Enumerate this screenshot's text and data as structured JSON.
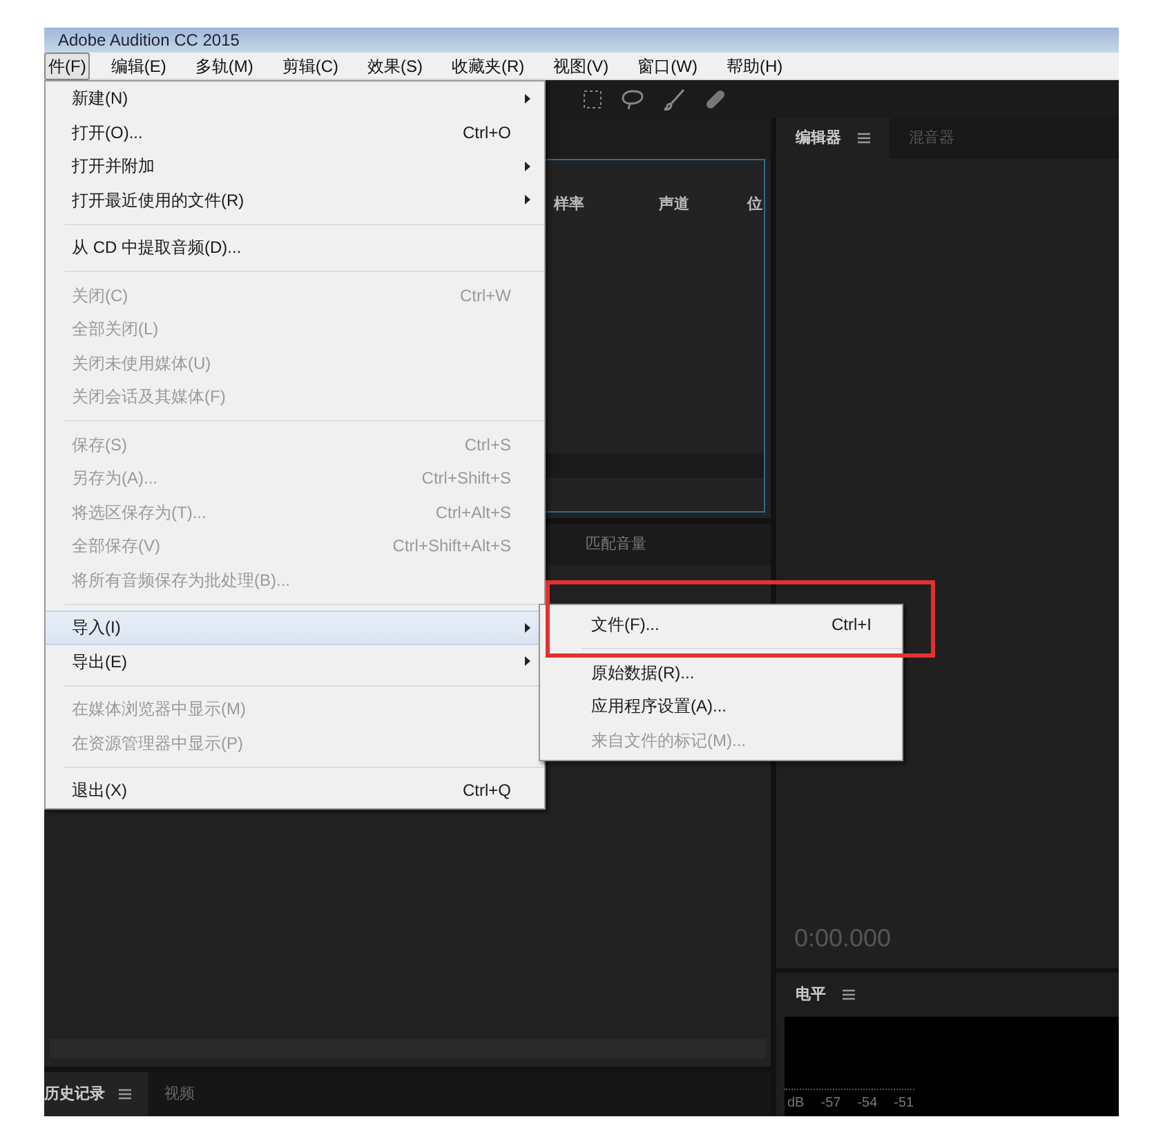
{
  "window": {
    "title": "Adobe Audition CC 2015"
  },
  "menubar": [
    {
      "label": "件(F)",
      "selected": true
    },
    {
      "label": "编辑(E)",
      "selected": false
    },
    {
      "label": "多轨(M)",
      "selected": false
    },
    {
      "label": "剪辑(C)",
      "selected": false
    },
    {
      "label": "效果(S)",
      "selected": false
    },
    {
      "label": "收藏夹(R)",
      "selected": false
    },
    {
      "label": "视图(V)",
      "selected": false
    },
    {
      "label": "窗口(W)",
      "selected": false
    },
    {
      "label": "帮助(H)",
      "selected": false
    }
  ],
  "file_menu": [
    {
      "kind": "item",
      "label": "新建(N)",
      "submenu": true,
      "disabled": false,
      "selected": false
    },
    {
      "kind": "item",
      "label": "打开(O)...",
      "shortcut": "Ctrl+O",
      "submenu": false,
      "disabled": false,
      "selected": false
    },
    {
      "kind": "item",
      "label": "打开并附加",
      "submenu": true,
      "disabled": false,
      "selected": false
    },
    {
      "kind": "item",
      "label": "打开最近使用的文件(R)",
      "submenu": true,
      "disabled": false,
      "selected": false
    },
    {
      "kind": "separator"
    },
    {
      "kind": "item",
      "label": "从 CD 中提取音频(D)...",
      "submenu": false,
      "disabled": false,
      "selected": false
    },
    {
      "kind": "separator"
    },
    {
      "kind": "item",
      "label": "关闭(C)",
      "shortcut": "Ctrl+W",
      "submenu": false,
      "disabled": true,
      "selected": false
    },
    {
      "kind": "item",
      "label": "全部关闭(L)",
      "submenu": false,
      "disabled": true,
      "selected": false
    },
    {
      "kind": "item",
      "label": "关闭未使用媒体(U)",
      "submenu": false,
      "disabled": true,
      "selected": false
    },
    {
      "kind": "item",
      "label": "关闭会话及其媒体(F)",
      "submenu": false,
      "disabled": true,
      "selected": false
    },
    {
      "kind": "separator"
    },
    {
      "kind": "item",
      "label": "保存(S)",
      "shortcut": "Ctrl+S",
      "submenu": false,
      "disabled": true,
      "selected": false
    },
    {
      "kind": "item",
      "label": "另存为(A)...",
      "shortcut": "Ctrl+Shift+S",
      "submenu": false,
      "disabled": true,
      "selected": false
    },
    {
      "kind": "item",
      "label": "将选区保存为(T)...",
      "shortcut": "Ctrl+Alt+S",
      "submenu": false,
      "disabled": true,
      "selected": false
    },
    {
      "kind": "item",
      "label": "全部保存(V)",
      "shortcut": "Ctrl+Shift+Alt+S",
      "submenu": false,
      "disabled": true,
      "selected": false
    },
    {
      "kind": "item",
      "label": "将所有音频保存为批处理(B)...",
      "submenu": false,
      "disabled": true,
      "selected": false
    },
    {
      "kind": "separator"
    },
    {
      "kind": "item",
      "label": "导入(I)",
      "submenu": true,
      "disabled": false,
      "selected": true
    },
    {
      "kind": "item",
      "label": "导出(E)",
      "submenu": true,
      "disabled": false,
      "selected": false
    },
    {
      "kind": "separator"
    },
    {
      "kind": "item",
      "label": "在媒体浏览器中显示(M)",
      "submenu": false,
      "disabled": true,
      "selected": false
    },
    {
      "kind": "item",
      "label": "在资源管理器中显示(P)",
      "submenu": false,
      "disabled": true,
      "selected": false
    },
    {
      "kind": "separator"
    },
    {
      "kind": "item",
      "label": "退出(X)",
      "shortcut": "Ctrl+Q",
      "submenu": false,
      "disabled": false,
      "selected": false
    }
  ],
  "import_submenu": [
    {
      "kind": "item",
      "label": "文件(F)...",
      "shortcut": "Ctrl+I",
      "disabled": false
    },
    {
      "kind": "separator"
    },
    {
      "kind": "item",
      "label": "原始数据(R)...",
      "disabled": false
    },
    {
      "kind": "item",
      "label": "应用程序设置(A)...",
      "disabled": false
    },
    {
      "kind": "item",
      "label": "来自文件的标记(M)...",
      "disabled": true
    }
  ],
  "files_panel": {
    "columns": [
      "样率",
      "声道",
      "位"
    ]
  },
  "match_volume_panel": {
    "tab": "匹配音量"
  },
  "bottom_tabs": [
    {
      "label": "历史记录",
      "selected": true
    },
    {
      "label": "视频",
      "selected": false
    }
  ],
  "editor_tabs": [
    {
      "label": "编辑器",
      "selected": true
    },
    {
      "label": "混音器",
      "selected": false
    }
  ],
  "editor": {
    "time": "0:00.000"
  },
  "level_panel": {
    "title": "电平",
    "scale": [
      "dB",
      "-57",
      "-54",
      "-51"
    ]
  }
}
